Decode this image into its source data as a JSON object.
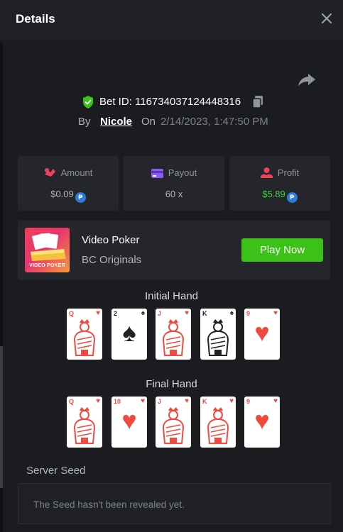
{
  "header": {
    "title": "Details"
  },
  "bet": {
    "id_text": "Bet ID: 116734037124448316",
    "by_label": "By",
    "user": "Nicole",
    "on_label": "On",
    "date": "2/14/2023, 1:47:50 PM"
  },
  "stats": {
    "amount": {
      "label": "Amount",
      "value": "$0.09",
      "coin": "₱"
    },
    "payout": {
      "label": "Payout",
      "value": "60 x"
    },
    "profit": {
      "label": "Profit",
      "value": "$5.89",
      "coin": "₱"
    }
  },
  "game": {
    "thumb_label": "VIDEO POKER",
    "name": "Video Poker",
    "provider": "BC Originals",
    "play_label": "Play Now"
  },
  "initial_hand": {
    "title": "Initial Hand",
    "cards": [
      {
        "rank": "Q",
        "suit": "♥",
        "color": "red"
      },
      {
        "rank": "2",
        "suit": "♠",
        "color": "black"
      },
      {
        "rank": "J",
        "suit": "♥",
        "color": "red"
      },
      {
        "rank": "K",
        "suit": "♠",
        "color": "black"
      },
      {
        "rank": "9",
        "suit": "♥",
        "color": "red"
      }
    ]
  },
  "final_hand": {
    "title": "Final Hand",
    "cards": [
      {
        "rank": "Q",
        "suit": "♥",
        "color": "red"
      },
      {
        "rank": "10",
        "suit": "♥",
        "color": "red"
      },
      {
        "rank": "J",
        "suit": "♥",
        "color": "red"
      },
      {
        "rank": "K",
        "suit": "♥",
        "color": "red"
      },
      {
        "rank": "9",
        "suit": "♥",
        "color": "red"
      }
    ]
  },
  "seed": {
    "label": "Server Seed",
    "text": "The Seed hasn't been revealed yet."
  },
  "colors": {
    "background": "#1a1c20",
    "panel": "#24262b",
    "accent_green": "#3bc117",
    "profit_green": "#3ed43e",
    "heart_red": "#f04a3e",
    "coin_blue": "#2f7bd6"
  }
}
